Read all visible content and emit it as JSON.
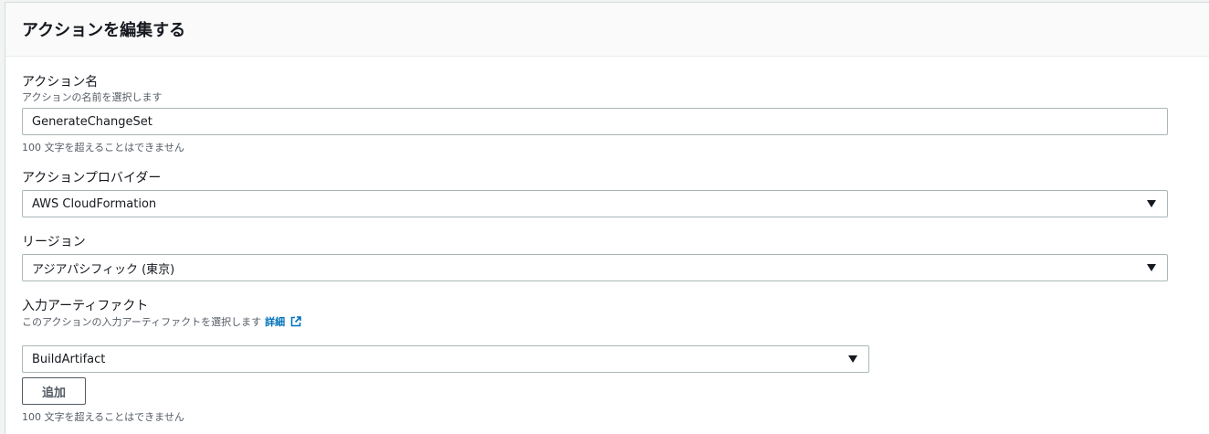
{
  "modal": {
    "title": "アクションを編集する"
  },
  "action_name": {
    "label": "アクション名",
    "description": "アクションの名前を選択します",
    "value": "GenerateChangeSet",
    "constraint": "100 文字を超えることはできません"
  },
  "action_provider": {
    "label": "アクションプロバイダー",
    "selected": "AWS CloudFormation"
  },
  "region": {
    "label": "リージョン",
    "selected": "アジアパシフィック (東京)"
  },
  "input_artifacts": {
    "label": "入力アーティファクト",
    "description": "このアクションの入力アーティファクトを選択します",
    "learn_more": "詳細",
    "selected": "BuildArtifact",
    "add_button": "追加",
    "constraint": "100 文字を超えることはできません"
  },
  "colors": {
    "link": "#0073bb",
    "border": "#aab7b8",
    "text_secondary": "#545b64"
  },
  "icons": [
    "external-link-icon",
    "caret-down-icon"
  ]
}
